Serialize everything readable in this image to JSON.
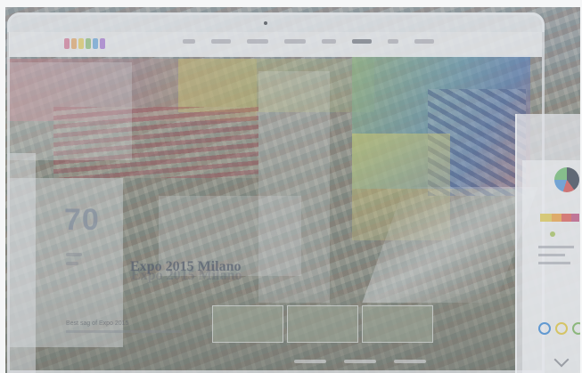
{
  "hero": {
    "number": "70",
    "title": "Expo 2015 Milano",
    "subtitle": "Best sag of Expo 2015"
  },
  "logo": {
    "colors": [
      "#c96a8a",
      "#d99a5a",
      "#d8c24f",
      "#7fb36a",
      "#5a9ad1",
      "#9a6ac9"
    ]
  },
  "right_device": {
    "ring_colors": [
      "#4b8ed1",
      "#d8c24f",
      "#7fb36a"
    ]
  },
  "colors": {
    "accent": "#4b8ed1",
    "brand_red": "#c94b4b",
    "brand_yellow": "#d8c24f"
  }
}
